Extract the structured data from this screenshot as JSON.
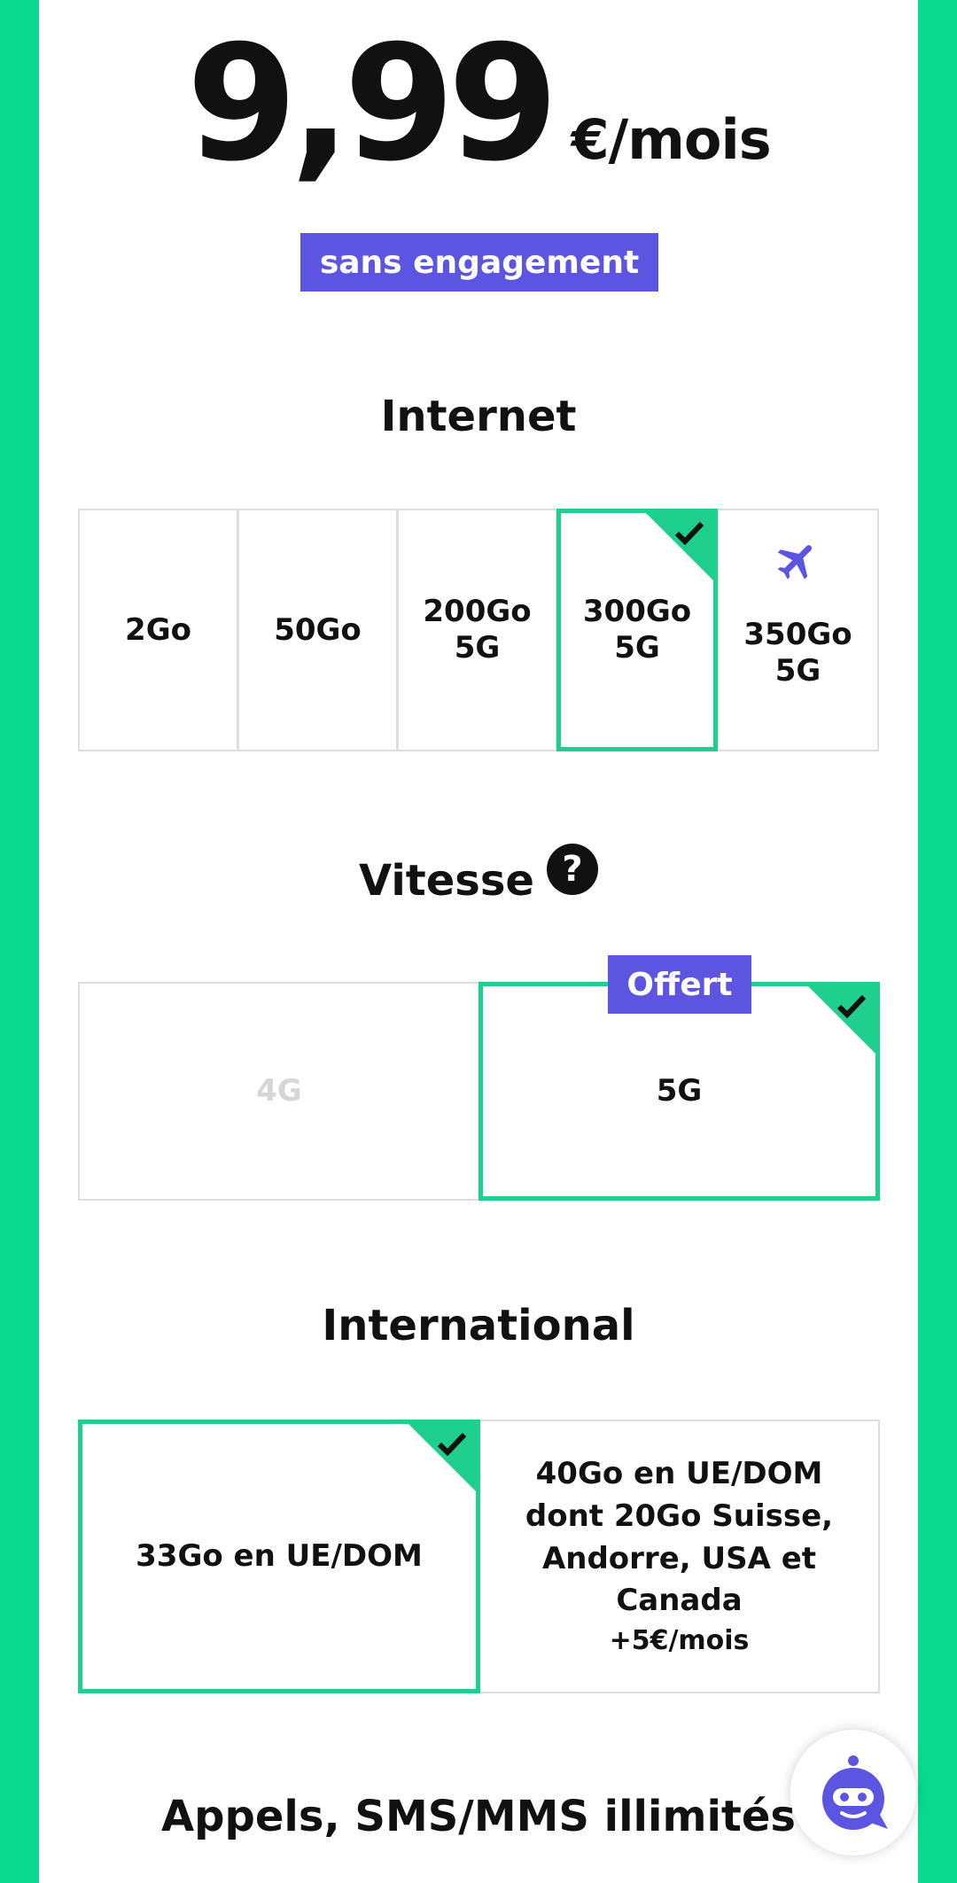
{
  "price": {
    "amount": "9,99",
    "unit": "€/mois"
  },
  "commitment_badge": "sans engagement",
  "internet": {
    "title": "Internet",
    "options": [
      {
        "line1": "2Go",
        "line2": "",
        "selected": false
      },
      {
        "line1": "50Go",
        "line2": "",
        "selected": false
      },
      {
        "line1": "200Go",
        "line2": "5G",
        "selected": false
      },
      {
        "line1": "300Go",
        "line2": "5G",
        "selected": true
      },
      {
        "line1": "350Go",
        "line2": "5G",
        "selected": false,
        "icon": "airplane-icon"
      }
    ]
  },
  "speed": {
    "title": "Vitesse",
    "help_glyph": "?",
    "offer_badge": "Offert",
    "options": [
      {
        "label": "4G",
        "selected": false,
        "disabled": true
      },
      {
        "label": "5G",
        "selected": true
      }
    ]
  },
  "international": {
    "title": "International",
    "options": [
      {
        "label": "33Go en UE/DOM",
        "selected": true
      },
      {
        "label": "40Go en UE/DOM dont 20Go Suisse, Andorre, USA et Canada",
        "price": "+5€/mois",
        "selected": false
      }
    ]
  },
  "calls_title": "Appels, SMS/MMS illimités",
  "colors": {
    "accent": "#1fcf8e",
    "background": "#08d98e",
    "badge": "#5b55e1"
  },
  "assistant": {
    "icon": "chatbot-icon"
  }
}
